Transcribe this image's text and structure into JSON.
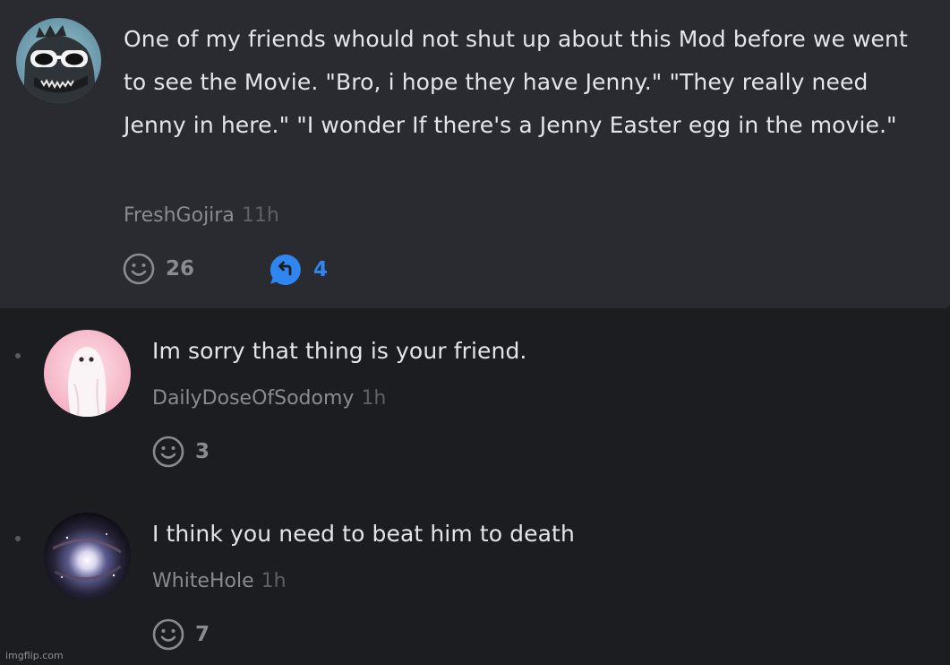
{
  "parent_comment": {
    "text": "One of my friends whould not shut up about this Mod before we went to see the Movie. \"Bro, i hope they have Jenny.\" \"They really need Jenny in here.\" \"I wonder If there's a Jenny Easter egg in the movie.\"",
    "author": "FreshGojira",
    "time": "11h",
    "likes": "26",
    "replies_count": "4",
    "avatar_icon": "godzilla-sunglasses-avatar"
  },
  "replies": [
    {
      "text": "Im sorry that thing is your friend.",
      "author": "DailyDoseOfSodomy",
      "time": "1h",
      "likes": "3",
      "avatar_icon": "ghost-avatar"
    },
    {
      "text": "I think you need to beat him to death",
      "author": "WhiteHole",
      "time": "1h",
      "likes": "7",
      "avatar_icon": "galaxy-avatar"
    }
  ],
  "watermark": "imgflip.com",
  "colors": {
    "background": "#1c1d21",
    "parent_background": "#2a2b30",
    "reply_accent": "#2f86f0"
  }
}
